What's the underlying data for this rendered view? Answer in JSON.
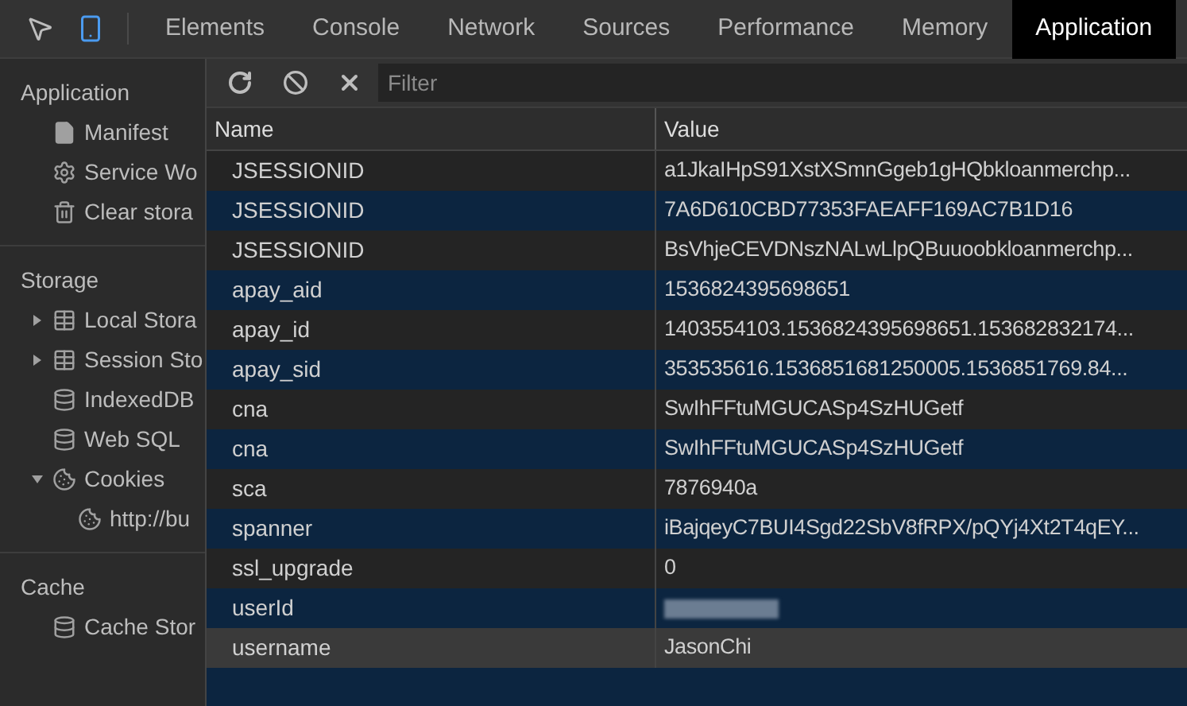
{
  "toolbar": {
    "tabs": [
      {
        "label": "Elements",
        "selected": false
      },
      {
        "label": "Console",
        "selected": false
      },
      {
        "label": "Network",
        "selected": false
      },
      {
        "label": "Sources",
        "selected": false
      },
      {
        "label": "Performance",
        "selected": false
      },
      {
        "label": "Memory",
        "selected": false
      },
      {
        "label": "Application",
        "selected": true
      }
    ],
    "device_mode": {
      "on": true
    }
  },
  "sidebar": {
    "sections": [
      {
        "title": "Application",
        "items": [
          {
            "label": "Manifest",
            "kind": "file"
          },
          {
            "label": "Service Wo",
            "kind": "gear"
          },
          {
            "label": "Clear stora",
            "kind": "trash"
          }
        ]
      },
      {
        "title": "Storage",
        "items": [
          {
            "label": "Local Stora",
            "kind": "grid",
            "expanded": false
          },
          {
            "label": "Session Sto",
            "kind": "grid",
            "expanded": false
          },
          {
            "label": "IndexedDB",
            "kind": "db"
          },
          {
            "label": "Web SQL",
            "kind": "db"
          },
          {
            "label": "Cookies",
            "kind": "cookie",
            "expanded": true,
            "children": [
              {
                "label": "http://bu",
                "kind": "cookie"
              }
            ]
          }
        ]
      },
      {
        "title": "Cache",
        "items": [
          {
            "label": "Cache Stor",
            "kind": "db"
          }
        ]
      }
    ]
  },
  "filter": {
    "placeholder": "Filter"
  },
  "table": {
    "columns": [
      "Name",
      "Value"
    ],
    "rows": [
      {
        "name": "JSESSIONID",
        "value": "a1JkaIHpS91XstXSmnGgeb1gHQbkloanmerchp...",
        "kind": "text",
        "selected": false
      },
      {
        "name": "JSESSIONID",
        "value": "7A6D610CBD77353FAEAFF169AC7B1D16",
        "kind": "text",
        "selected": false
      },
      {
        "name": "JSESSIONID",
        "value": "BsVhjeCEVDNszNALwLlpQBuuoobkloanmerchp...",
        "kind": "text",
        "selected": false
      },
      {
        "name": "apay_aid",
        "value": "1536824395698651",
        "kind": "text",
        "selected": false
      },
      {
        "name": "apay_id",
        "value": "1403554103.1536824395698651.153682832174...",
        "kind": "text",
        "selected": false
      },
      {
        "name": "apay_sid",
        "value": "353535616.1536851681250005.1536851769.84...",
        "kind": "text",
        "selected": false
      },
      {
        "name": "cna",
        "value": "SwIhFFtuMGUCASp4SzHUGetf",
        "kind": "text",
        "selected": false
      },
      {
        "name": "cna",
        "value": "SwIhFFtuMGUCASp4SzHUGetf",
        "kind": "text",
        "selected": false
      },
      {
        "name": "sca",
        "value": "7876940a",
        "kind": "text",
        "selected": false
      },
      {
        "name": "spanner",
        "value": "iBajqeyC7BUI4Sgd22SbV8fRPX/pQYj4Xt2T4qEY...",
        "kind": "text",
        "selected": false
      },
      {
        "name": "ssl_upgrade",
        "value": "0",
        "kind": "text",
        "selected": false
      },
      {
        "name": "userId",
        "kind": "redacted",
        "selected": false
      },
      {
        "name": "username",
        "value": "JasonChi",
        "kind": "text",
        "selected": true
      }
    ]
  }
}
